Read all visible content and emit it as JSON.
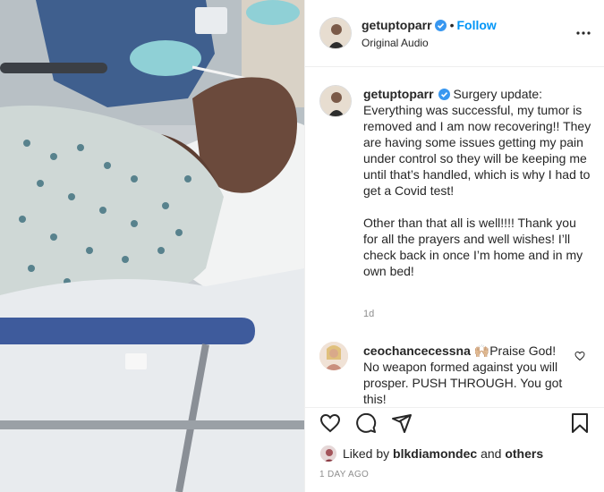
{
  "header": {
    "username": "getuptoparr",
    "separator": "•",
    "follow_label": "Follow",
    "audio_label": "Original Audio"
  },
  "caption": {
    "username": "getuptoparr",
    "text": "Surgery update: Everything was successful, my tumor is removed and I am now recovering!! They are having some issues getting my pain under control so they will be keeping me until that’s handled, which is why I had to get a Covid test!\n\nOther than that all is well!!!! Thank you for all the prayers and well wishes! I’ll check back in once I’m home and in my own bed!",
    "age": "1d"
  },
  "comment": {
    "username": "ceochancecessna",
    "emoji": "🙌🏼",
    "text": "Praise God! No weapon formed against you will prosper. PUSH THROUGH. You got this!"
  },
  "likes": {
    "prefix": "Liked by",
    "user": "blkdiamondec",
    "middle": "and",
    "others": "others"
  },
  "date": "1 DAY AGO",
  "colors": {
    "accent": "#0095f6",
    "text": "#262626",
    "muted": "#8e8e8e",
    "divider": "#efefef"
  },
  "icons": [
    "verified-badge-icon",
    "more-options-icon",
    "heart-icon",
    "comment-icon",
    "share-icon",
    "bookmark-icon"
  ]
}
